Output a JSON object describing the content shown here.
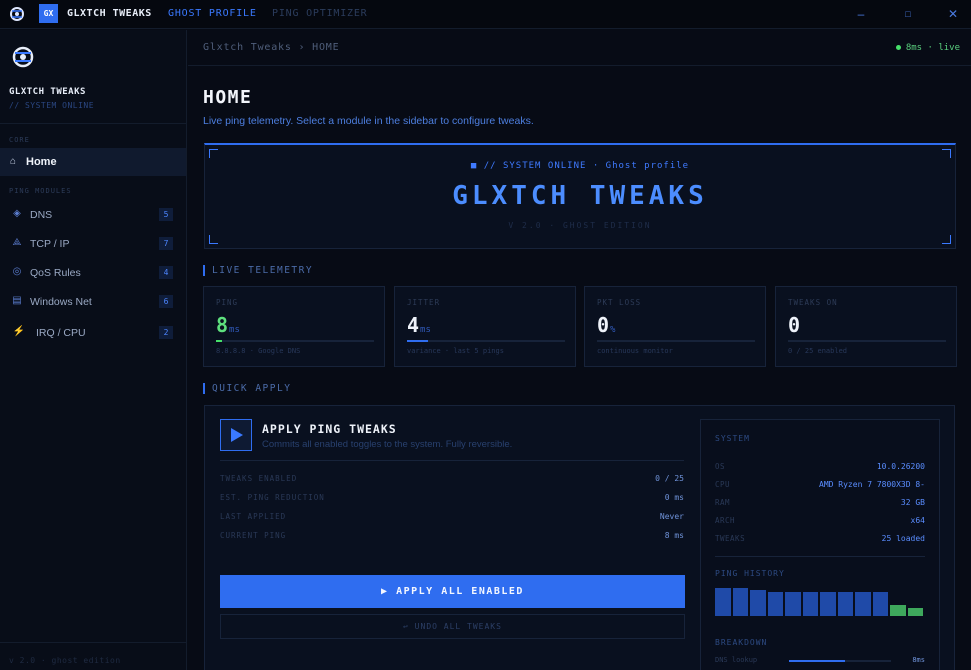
{
  "app": {
    "badge": "GX",
    "title": "GLXTCH TWEAKS",
    "tabs": [
      {
        "label": "GHOST PROFILE",
        "active": true
      },
      {
        "label": "PING OPTIMIZER",
        "active": false
      }
    ],
    "window_controls": {
      "minimize": "–",
      "maximize": "□",
      "close": "✕"
    }
  },
  "sidebar": {
    "brand": "GLXTCH TWEAKS",
    "status": "// SYSTEM ONLINE",
    "core_label": "CORE",
    "home": {
      "label": "Home",
      "icon": "home-icon"
    },
    "modules_label": "PING MODULES",
    "items": [
      {
        "label": "DNS",
        "count": "5",
        "icon": "dns-icon"
      },
      {
        "label": "TCP / IP",
        "count": "7",
        "icon": "network-icon"
      },
      {
        "label": "QoS Rules",
        "count": "4",
        "icon": "qos-icon"
      },
      {
        "label": "Windows Net",
        "count": "6",
        "icon": "windows-icon"
      },
      {
        "label": "IRQ / CPU",
        "count": "2",
        "icon": "lightning-icon"
      }
    ],
    "footer": "v 2.0 · ghost edition"
  },
  "header": {
    "breadcrumb": "Glxtch Tweaks  ›  HOME",
    "live": "8ms · live"
  },
  "page": {
    "title": "HOME",
    "subtitle": "Live ping telemetry. Select a module in the sidebar to configure tweaks."
  },
  "banner": {
    "status": "■ // SYSTEM ONLINE · Ghost profile",
    "title": "GLXTCH TWEAKS",
    "version": "V 2.0 · GHOST EDITION"
  },
  "telemetry": {
    "heading": "LIVE TELEMETRY",
    "cards": [
      {
        "label": "PING",
        "value": "8",
        "unit": "ms",
        "sub": "8.8.8.8 · Google DNS",
        "level": 0.04,
        "color": "#46e06a"
      },
      {
        "label": "JITTER",
        "value": "4",
        "unit": "ms",
        "sub": "variance · last 5 pings",
        "level": 0.13,
        "color": "#2f6df0"
      },
      {
        "label": "PKT LOSS",
        "value": "0",
        "unit": "%",
        "sub": "continuous monitor",
        "level": 0,
        "color": "#2f6df0"
      },
      {
        "label": "TWEAKS ON",
        "value": "0",
        "unit": "",
        "sub": "0 / 25 enabled",
        "level": 0,
        "color": "#2f6df0"
      }
    ]
  },
  "quick_apply": {
    "heading": "QUICK APPLY",
    "title": "APPLY PING TWEAKS",
    "subtitle": "Commits all enabled toggles to the system. Fully reversible.",
    "rows": [
      {
        "label": "TWEAKS ENABLED",
        "value": "0 / 25"
      },
      {
        "label": "EST. PING REDUCTION",
        "value": "0 ms"
      },
      {
        "label": "LAST APPLIED",
        "value": "Never"
      },
      {
        "label": "CURRENT PING",
        "value": "8 ms"
      }
    ],
    "apply_label": "▶  APPLY ALL ENABLED",
    "undo_label": "↩  UNDO ALL TWEAKS"
  },
  "system": {
    "heading": "SYSTEM",
    "rows": [
      {
        "label": "OS",
        "value": "10.0.26200"
      },
      {
        "label": "CPU",
        "value": "AMD Ryzen 7 7800X3D 8-"
      },
      {
        "label": "RAM",
        "value": "32 GB"
      },
      {
        "label": "ARCH",
        "value": "x64"
      },
      {
        "label": "TWEAKS",
        "value": "25 loaded"
      }
    ],
    "ping_history_heading": "PING HISTORY",
    "ping_history": [
      {
        "v": 0.88,
        "color": "#1f4aa8"
      },
      {
        "v": 0.86,
        "color": "#1f4aa8"
      },
      {
        "v": 0.82,
        "color": "#1f4aa8"
      },
      {
        "v": 0.76,
        "color": "#1f4aa8"
      },
      {
        "v": 0.76,
        "color": "#1f4aa8"
      },
      {
        "v": 0.76,
        "color": "#1f4aa8"
      },
      {
        "v": 0.76,
        "color": "#1f4aa8"
      },
      {
        "v": 0.76,
        "color": "#1f4aa8"
      },
      {
        "v": 0.76,
        "color": "#1f4aa8"
      },
      {
        "v": 0.76,
        "color": "#1f4aa8"
      },
      {
        "v": 0.33,
        "color": "#3ea85c"
      },
      {
        "v": 0.25,
        "color": "#3ea85c"
      }
    ],
    "breakdown_heading": "BREAKDOWN",
    "breakdown": [
      {
        "label": "DNS lookup",
        "value": "8ms",
        "level": 0.55
      }
    ]
  }
}
